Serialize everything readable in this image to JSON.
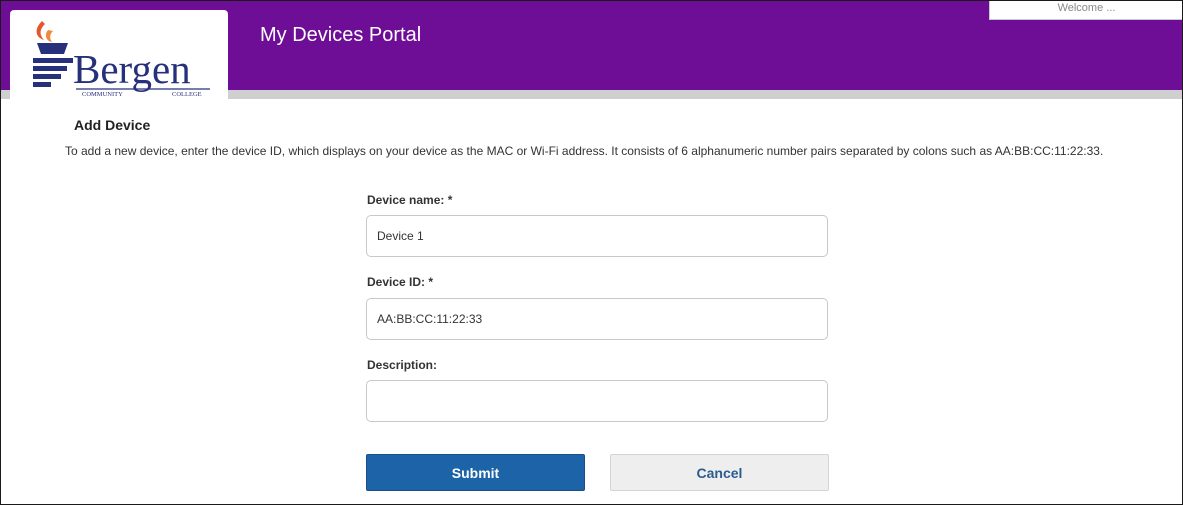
{
  "header": {
    "portal_title": "My Devices Portal",
    "welcome_text": "Welcome ..."
  },
  "logo": {
    "name": "Bergen",
    "sub_left": "COMMUNITY",
    "sub_right": "COLLEGE"
  },
  "form": {
    "section_title": "Add Device",
    "instructions": "To add a new device, enter the device ID, which displays on your device as the MAC or Wi-Fi address. It consists of 6 alphanumeric number pairs separated by colons such as AA:BB:CC:11:22:33.",
    "device_name": {
      "label": "Device name: *",
      "value": "Device 1"
    },
    "device_id": {
      "label": "Device ID: *",
      "value": "AA:BB:CC:11:22:33"
    },
    "description": {
      "label": "Description:",
      "value": ""
    },
    "submit_label": "Submit",
    "cancel_label": "Cancel"
  },
  "colors": {
    "header_purple": "#6e0e97",
    "submit_blue": "#1d63a8",
    "logo_navy": "#27307a",
    "logo_flame": "#e2582a"
  }
}
